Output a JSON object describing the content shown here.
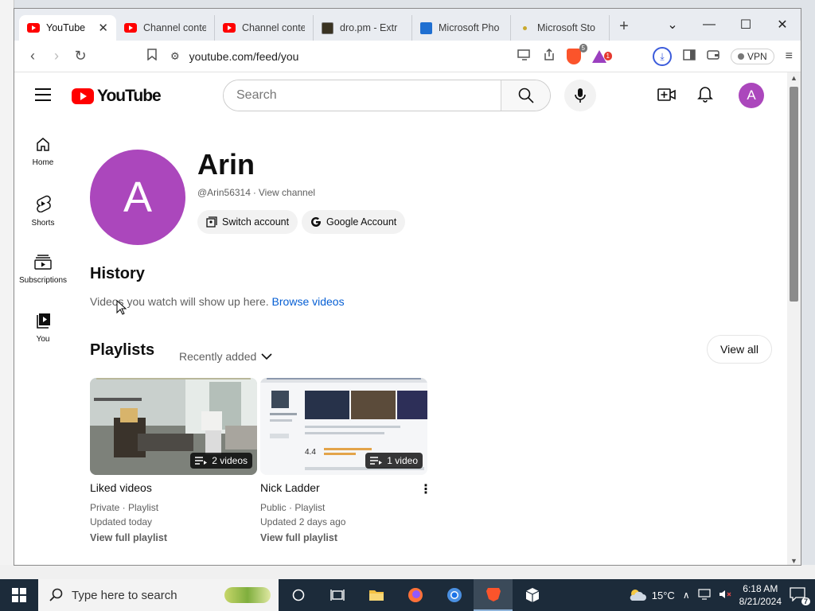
{
  "tabs": [
    {
      "title": "YouTube",
      "favicon": "youtube",
      "active": true
    },
    {
      "title": "Channel conte",
      "favicon": "youtube"
    },
    {
      "title": "Channel conte",
      "favicon": "youtube"
    },
    {
      "title": "dro.pm - Extr",
      "favicon": "dro"
    },
    {
      "title": "Microsoft Pho",
      "favicon": "microsoft"
    },
    {
      "title": "Microsoft Sto",
      "favicon": "dot"
    }
  ],
  "address": {
    "url": "youtube.com/feed/you"
  },
  "browser": {
    "vpn_label": "VPN",
    "brave_badge": "5",
    "rewards_badge": "1"
  },
  "yt": {
    "logo_text": "YouTube",
    "search_placeholder": "Search",
    "avatar_letter": "A",
    "guide": [
      {
        "label": "Home",
        "icon": "home-icon"
      },
      {
        "label": "Shorts",
        "icon": "shorts-icon"
      },
      {
        "label": "Subscriptions",
        "icon": "subscriptions-icon"
      },
      {
        "label": "You",
        "icon": "you-icon"
      }
    ]
  },
  "channel": {
    "avatar_letter": "A",
    "name": "Arin",
    "handle": "@Arin56314",
    "separator": "·",
    "view_channel": "View channel",
    "switch_account": "Switch account",
    "google_account": "Google Account"
  },
  "history": {
    "title": "History",
    "text": "Videos you watch will show up here.",
    "link": "Browse videos"
  },
  "playlists": {
    "title": "Playlists",
    "sort": "Recently added",
    "view_all": "View all",
    "items": [
      {
        "title": "Liked videos",
        "count": "2 videos",
        "privacy": "Private · Playlist",
        "updated": "Updated today",
        "link": "View full playlist",
        "stack_color": "#b9b79a"
      },
      {
        "title": "Nick Ladder",
        "count": "1 video",
        "privacy": "Public · Playlist",
        "updated": "Updated 2 days ago",
        "link": "View full playlist",
        "stack_color": "#8c99ad"
      }
    ]
  },
  "taskbar": {
    "search_placeholder": "Type here to search",
    "weather": "15°C",
    "weather_badge": "1",
    "time": "6:18 AM",
    "date": "8/21/2024",
    "notif_count": "7"
  },
  "colors": {
    "yt_red": "#ff0000",
    "avatar_purple": "#ab47bc",
    "link_blue": "#065fd4"
  }
}
